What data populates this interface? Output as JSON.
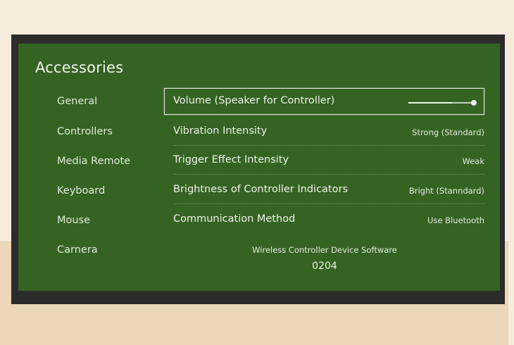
{
  "screen": {
    "title": "Accessories"
  },
  "sidebar": {
    "items": [
      {
        "label": "General"
      },
      {
        "label": "Controllers"
      },
      {
        "label": "Media Remote"
      },
      {
        "label": "Keyboard"
      },
      {
        "label": "Mouse"
      },
      {
        "label": "Carnera"
      }
    ]
  },
  "settings": {
    "rows": [
      {
        "label": "Volume (Speaker for Controller)",
        "control": "slider",
        "level": 0.67
      },
      {
        "label": "Vibration Intensity",
        "value": "Strong (Standard)"
      },
      {
        "label": "Trigger Effect Intensity",
        "value": "Weak"
      },
      {
        "label": "Brightness of Controller Indicators",
        "value": "Bright (Stanndard)"
      },
      {
        "label": "Communication Method",
        "value": "Use Bluetooth"
      }
    ]
  },
  "software": {
    "label": "Wireless Controller Device Software",
    "version": "0204"
  },
  "colors": {
    "screen_background": "#356322",
    "frame": "#2c2c2c",
    "wall": "#f7ecdc",
    "floor": "#ecd7b8"
  }
}
